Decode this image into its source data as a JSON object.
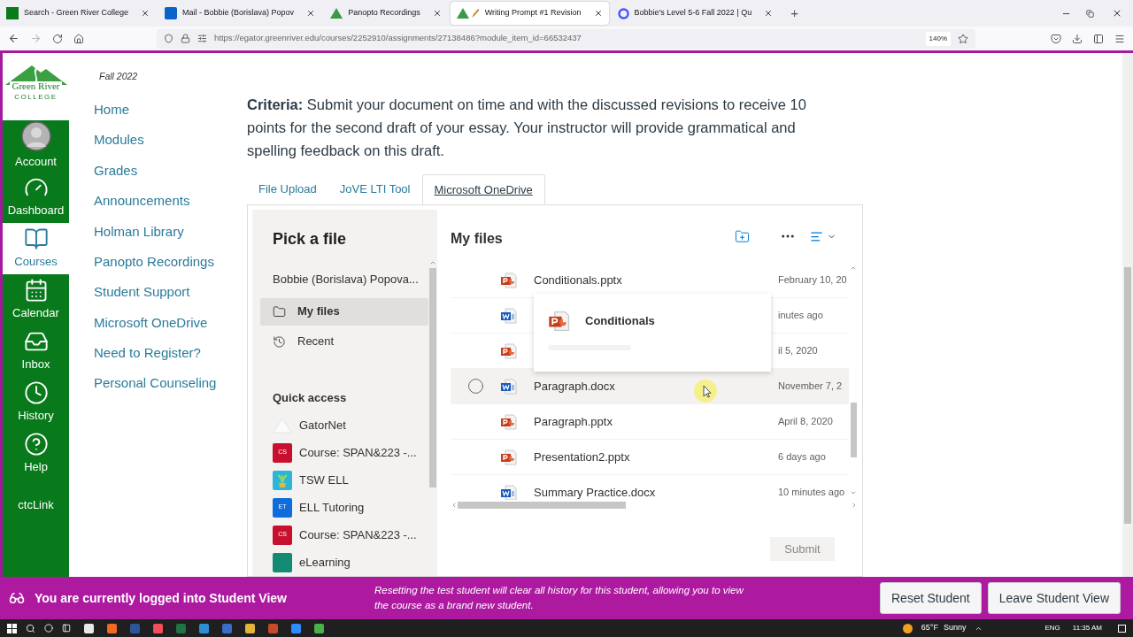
{
  "browser": {
    "tabs": [
      {
        "title": "Search - Green River College",
        "selected": false
      },
      {
        "title": "Mail - Bobbie (Borislava) Popov",
        "selected": false
      },
      {
        "title": "Panopto Recordings",
        "selected": false
      },
      {
        "title": "Writing Prompt #1 Revision",
        "selected": true
      },
      {
        "title": "Bobbie's Level 5-6 Fall 2022 | Qu",
        "selected": false
      }
    ],
    "new_tab": "+",
    "url": "https://egator.greenriver.edu/courses/2252910/assignments/27138486?module_item_id=66532437",
    "zoom": "140%"
  },
  "logo": {
    "name": "Green River",
    "sub": "COLLEGE"
  },
  "global_nav": [
    {
      "label": "Account",
      "kind": "account",
      "selected": false
    },
    {
      "label": "Dashboard",
      "kind": "dashboard",
      "selected": false
    },
    {
      "label": "Courses",
      "kind": "courses",
      "selected": true
    },
    {
      "label": "Calendar",
      "kind": "calendar",
      "selected": false
    },
    {
      "label": "Inbox",
      "kind": "inbox",
      "selected": false
    },
    {
      "label": "History",
      "kind": "history",
      "selected": false
    },
    {
      "label": "Help",
      "kind": "help",
      "selected": false
    },
    {
      "label": "ctcLink",
      "kind": "link",
      "selected": false
    }
  ],
  "course_nav": {
    "term": "Fall 2022",
    "items": [
      "Home",
      "Modules",
      "Grades",
      "Announcements",
      "Holman Library",
      "Panopto Recordings",
      "Student Support",
      "Microsoft OneDrive",
      "Need to Register?",
      "Personal Counseling"
    ]
  },
  "criteria": "**Criteria:** Submit your document on time and with the discussed revisions to receive 10 points for the second draft of your essay. Your instructor will provide grammatical and spelling feedback on this draft.",
  "submission_tabs": [
    {
      "label": "File Upload",
      "selected": false
    },
    {
      "label": "JoVE LTI Tool",
      "selected": false
    },
    {
      "label": "Microsoft OneDrive",
      "selected": true
    }
  ],
  "picker": {
    "title": "Pick a file",
    "account": "Bobbie (Borislava) Popova...",
    "nav": [
      {
        "label": "My files",
        "kind": "folder",
        "selected": true
      },
      {
        "label": "Recent",
        "kind": "recent",
        "selected": false
      }
    ],
    "quick_access_title": "Quick access",
    "quick_access": [
      {
        "label": "GatorNet",
        "kind": "mountain"
      },
      {
        "label": "Course: SPAN&223 -...",
        "kind": "tile",
        "abbr": "CS",
        "color": "#c8102e"
      },
      {
        "label": "TSW ELL",
        "kind": "plant",
        "color": "#2bb5d8"
      },
      {
        "label": "ELL Tutoring",
        "kind": "tile",
        "abbr": "ET",
        "color": "#0f6cdb"
      },
      {
        "label": "Course: SPAN&223 -...",
        "kind": "tile",
        "abbr": "CS",
        "color": "#c8102e"
      },
      {
        "label": "eLearning",
        "kind": "tile",
        "color": "#138a72"
      }
    ],
    "files_title": "My files",
    "files": [
      {
        "name": "Conditionals.pptx",
        "kind": "pptx",
        "date": "February 10, 20",
        "hovered": false
      },
      {
        "kind": "docx",
        "date": "inutes ago",
        "hovered": false
      },
      {
        "kind": "pptx",
        "date": "il 5, 2020",
        "hovered": false
      },
      {
        "name": "Paragraph.docx",
        "kind": "docx",
        "date": "November 7, 2",
        "hovered": true
      },
      {
        "name": "Paragraph.pptx",
        "kind": "pptx",
        "date": "April 8, 2020",
        "hovered": false
      },
      {
        "name": "Presentation2.pptx",
        "kind": "pptx",
        "date": "6 days ago",
        "hovered": false
      },
      {
        "name": "Summary Practice.docx",
        "kind": "docx",
        "date": "10 minutes ago",
        "hovered": false
      }
    ],
    "preview": {
      "title": "Conditionals",
      "kind": "pptx"
    },
    "submit": {
      "label": "Submit",
      "disabled": true
    }
  },
  "student_view": {
    "status": "You are currently logged into Student View",
    "message": "Resetting the test student will clear all history for this student, allowing you to view the course as a brand new student.",
    "buttons": [
      "Reset Student",
      "Leave Student View"
    ]
  },
  "taskbar": {
    "weather": "65°F",
    "condition": "Sunny",
    "language": "ENG",
    "time": "11:35 AM"
  }
}
